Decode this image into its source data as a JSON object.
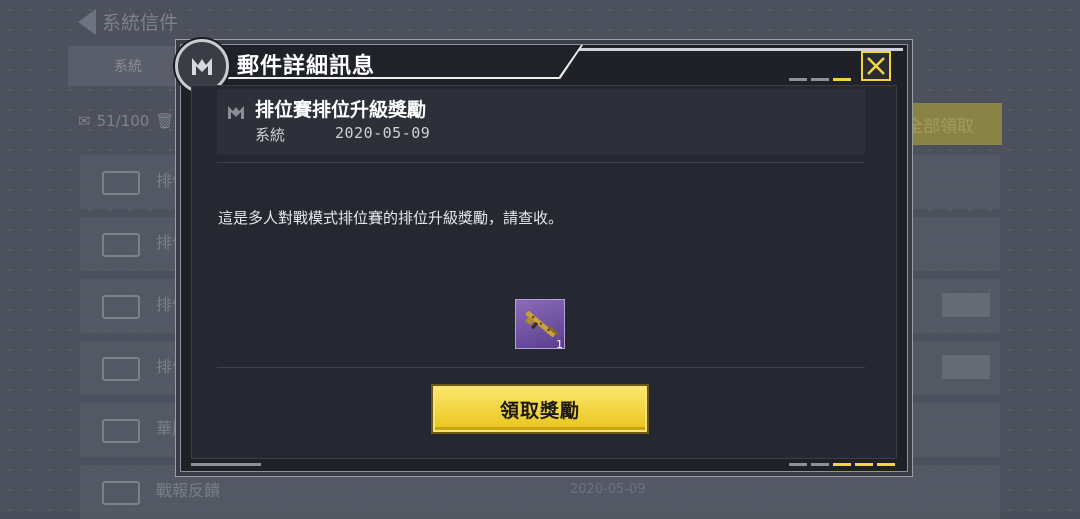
{
  "background": {
    "header_title": "系統信件",
    "tab_label": "系統",
    "mail_count": "51/100",
    "claim_all_label": "全部領取",
    "rows": [
      {
        "text": "排位"
      },
      {
        "text": "排位"
      },
      {
        "text": "排位"
      },
      {
        "text": "排位"
      },
      {
        "text": "華麗"
      },
      {
        "text": "戰報反饋"
      }
    ],
    "footer_date": "2020-05-09"
  },
  "modal": {
    "title": "郵件詳細訊息",
    "mail": {
      "subject": "排位賽排位升級獎勵",
      "sender": "系統",
      "date": "2020-05-09",
      "body": "這是多人對戰模式排位賽的排位升級獎勵，請查收。"
    },
    "reward": {
      "icon": "rifle-icon",
      "quantity": "1"
    },
    "claim_button_label": "領取獎勵"
  },
  "colors": {
    "accent_yellow": "#f1d641",
    "modal_bg": "#1f2127",
    "reward_rarity_purple": "#6f52a3"
  }
}
